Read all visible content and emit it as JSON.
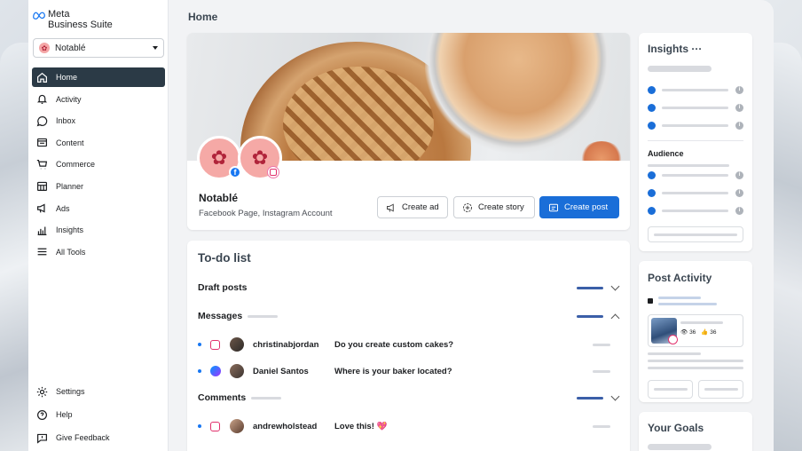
{
  "app": {
    "brand_line1": "Meta",
    "brand_line2": "Business Suite"
  },
  "account": {
    "name": "Notablé"
  },
  "sidebar": {
    "items": [
      {
        "label": "Home",
        "icon": "home-icon",
        "active": true
      },
      {
        "label": "Activity",
        "icon": "bell-icon"
      },
      {
        "label": "Inbox",
        "icon": "chat-bubble-icon"
      },
      {
        "label": "Content",
        "icon": "content-icon"
      },
      {
        "label": "Commerce",
        "icon": "cart-icon"
      },
      {
        "label": "Planner",
        "icon": "calendar-icon"
      },
      {
        "label": "Ads",
        "icon": "megaphone-icon"
      },
      {
        "label": "Insights",
        "icon": "bar-chart-icon"
      },
      {
        "label": "All Tools",
        "icon": "menu-icon"
      }
    ],
    "bottom": [
      {
        "label": "Settings",
        "icon": "gear-icon"
      },
      {
        "label": "Help",
        "icon": "help-icon"
      },
      {
        "label": "Give Feedback",
        "icon": "feedback-icon"
      }
    ]
  },
  "main": {
    "title": "Home"
  },
  "profile": {
    "name": "Notablé",
    "subtitle": "Facebook Page, Instagram Account",
    "buttons": {
      "create_ad": "Create ad",
      "create_story": "Create story",
      "create_post": "Create post"
    }
  },
  "todo": {
    "title": "To-do list",
    "sections": {
      "drafts": "Draft posts",
      "messages": "Messages",
      "comments": "Comments"
    },
    "messages": [
      {
        "user": "christinabjordan",
        "text": "Do you create custom cakes?",
        "source": "instagram-icon"
      },
      {
        "user": "Daniel Santos",
        "text": "Where is your baker located?",
        "source": "messenger-icon"
      }
    ],
    "comments": [
      {
        "user": "andrewholstead",
        "text": "Love this! 💖",
        "source": "instagram-icon"
      }
    ]
  },
  "right": {
    "insights_title": "Insights ···",
    "audience_label": "Audience",
    "post_activity_title": "Post Activity",
    "views": "36",
    "likes": "36",
    "goals_title": "Your Goals"
  },
  "colors": {
    "accent": "#1a6ed8",
    "nav_active": "#2b3a46"
  }
}
